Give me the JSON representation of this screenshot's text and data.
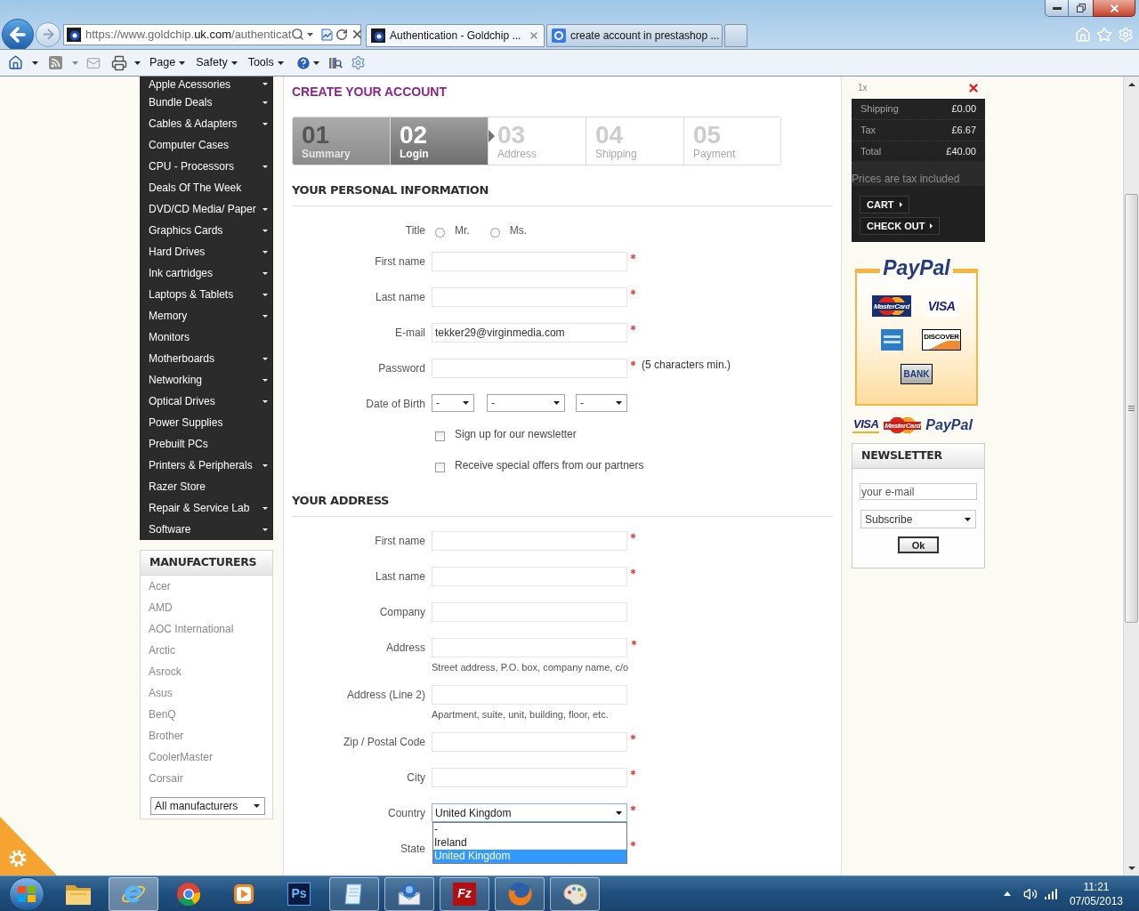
{
  "browser": {
    "url": {
      "host": "https://www.goldchip.",
      "domain": "uk.com",
      "path": "/authenticat"
    },
    "tabs": [
      {
        "title": "Authentication - Goldchip ...",
        "selected": true
      },
      {
        "title": "create account in prestashop ...",
        "selected": false
      }
    ],
    "menus": [
      "Page",
      "Safety",
      "Tools"
    ]
  },
  "categories": [
    {
      "label": "Apple Acessories",
      "submenu": true
    },
    {
      "label": "Bundle Deals",
      "submenu": true
    },
    {
      "label": "Cables & Adapters",
      "submenu": true
    },
    {
      "label": "Computer Cases",
      "submenu": false
    },
    {
      "label": "CPU - Processors",
      "submenu": true
    },
    {
      "label": "Deals Of The Week",
      "submenu": false
    },
    {
      "label": "DVD/CD Media/ Paper",
      "submenu": true
    },
    {
      "label": "Graphics Cards",
      "submenu": true
    },
    {
      "label": "Hard Drives",
      "submenu": true
    },
    {
      "label": "Ink cartridges",
      "submenu": true
    },
    {
      "label": "Laptops & Tablets",
      "submenu": true
    },
    {
      "label": "Memory",
      "submenu": true
    },
    {
      "label": "Monitors",
      "submenu": false
    },
    {
      "label": "Motherboards",
      "submenu": true
    },
    {
      "label": "Networking",
      "submenu": true
    },
    {
      "label": "Optical Drives",
      "submenu": true
    },
    {
      "label": "Power Supplies",
      "submenu": false
    },
    {
      "label": "Prebuilt PCs",
      "submenu": false
    },
    {
      "label": "Printers & Peripherals",
      "submenu": true
    },
    {
      "label": "Razer Store",
      "submenu": false
    },
    {
      "label": "Repair & Service Lab",
      "submenu": true
    },
    {
      "label": "Software",
      "submenu": true
    }
  ],
  "manufacturers": {
    "title": "MANUFACTURERS",
    "items": [
      "Acer",
      "AMD",
      "AOC International",
      "Arctic",
      "Asrock",
      "Asus",
      "BenQ",
      "Brother",
      "CoolerMaster",
      "Corsair"
    ],
    "select": "All manufacturers"
  },
  "page_title": "CREATE YOUR ACCOUNT",
  "steps": [
    {
      "number": "01",
      "label": "Summary",
      "done": true,
      "selected": false
    },
    {
      "number": "02",
      "label": "Login",
      "done": false,
      "selected": true
    },
    {
      "number": "03",
      "label": "Address",
      "done": false,
      "selected": false
    },
    {
      "number": "04",
      "label": "Shipping",
      "done": false,
      "selected": false
    },
    {
      "number": "05",
      "label": "Payment",
      "done": false,
      "selected": false
    }
  ],
  "personal": {
    "heading": "YOUR PERSONAL INFORMATION",
    "fields": [
      {
        "kind": "radio",
        "label": "Title",
        "options": [
          {
            "label": "Mr.",
            "selected": false
          },
          {
            "label": "Ms.",
            "selected": false
          }
        ]
      },
      {
        "kind": "text",
        "label": "First name",
        "required": true
      },
      {
        "kind": "text",
        "label": "Last name",
        "required": true
      },
      {
        "kind": "text",
        "label": "E-mail",
        "value": "tekker29@virginmedia.com",
        "required": true
      },
      {
        "kind": "text",
        "label": "Password",
        "required": true,
        "note": "(5 characters min.)"
      },
      {
        "kind": "date",
        "label": "Date of Birth",
        "selects": [
          "-",
          "-",
          "-"
        ]
      },
      {
        "kind": "checkbox",
        "label": "Sign up for our newsletter",
        "checked": false
      },
      {
        "kind": "checkbox",
        "label": "Receive special offers from our partners",
        "checked": false
      }
    ]
  },
  "address": {
    "heading": "YOUR ADDRESS",
    "fields": [
      {
        "kind": "text",
        "label": "First name",
        "required": true
      },
      {
        "kind": "text",
        "label": "Last name",
        "required": true
      },
      {
        "kind": "text",
        "label": "Company",
        "required": false
      },
      {
        "kind": "text",
        "label": "Address",
        "required": true,
        "hint": "Street address, P.O. box, company name, c/o"
      },
      {
        "kind": "text",
        "label": "Address (Line 2)",
        "required": false,
        "hint": "Apartment, suite, unit, building, floor, etc."
      },
      {
        "kind": "text",
        "label": "Zip / Postal Code",
        "required": true
      },
      {
        "kind": "text",
        "label": "City",
        "required": true
      },
      {
        "kind": "select",
        "label": "Country",
        "value": "United Kingdom",
        "required": true,
        "open": true,
        "options": [
          {
            "label": "-",
            "selected": false
          },
          {
            "label": "Ireland",
            "selected": false
          },
          {
            "label": "United Kingdom",
            "selected": true
          }
        ]
      },
      {
        "kind": "covered",
        "label": "State",
        "required": true
      }
    ]
  },
  "cart": {
    "quantity": "1x",
    "rows": [
      {
        "label": "Shipping",
        "value": "£0.00"
      },
      {
        "label": "Tax",
        "value": "£6.67"
      },
      {
        "label": "Total",
        "value": "£40.00"
      }
    ],
    "note": "Prices are tax included",
    "buttons": [
      "CART",
      "CHECK OUT"
    ]
  },
  "payment_box": {
    "title": "PayPal",
    "logos": [
      {
        "kind": "mastercard",
        "text": "MasterCard"
      },
      {
        "kind": "visa",
        "text": "VISA"
      },
      {
        "kind": "amex"
      },
      {
        "kind": "discover",
        "text": "DISCOVER"
      },
      {
        "kind": "bank",
        "text": "BANK"
      }
    ]
  },
  "payment_strip": [
    {
      "kind": "visa",
      "text": "VISA"
    },
    {
      "kind": "mastercard",
      "text": "MasterCard"
    },
    {
      "kind": "paypal",
      "text": "PayPal"
    }
  ],
  "newsletter": {
    "title": "NEWSLETTER",
    "placeholder": "your e-mail",
    "select": "Subscribe",
    "button": "Ok"
  },
  "taskbar": {
    "apps": [
      {
        "kind": "explorer",
        "running": false,
        "selected": false
      },
      {
        "kind": "ie",
        "running": true,
        "selected": true
      },
      {
        "kind": "chrome",
        "running": false,
        "selected": false
      },
      {
        "kind": "media",
        "running": false,
        "selected": false
      },
      {
        "kind": "ps",
        "label": "Ps",
        "running": false,
        "selected": false
      },
      {
        "kind": "notepad",
        "running": true,
        "selected": false
      },
      {
        "kind": "mail",
        "running": true,
        "selected": false
      },
      {
        "kind": "ftp",
        "label": "Fz",
        "running": true,
        "selected": false
      },
      {
        "kind": "firefox",
        "running": true,
        "selected": false
      },
      {
        "kind": "paint",
        "running": true,
        "selected": false
      }
    ],
    "clock": {
      "time": "11:21",
      "date": "07/05/2013"
    }
  }
}
